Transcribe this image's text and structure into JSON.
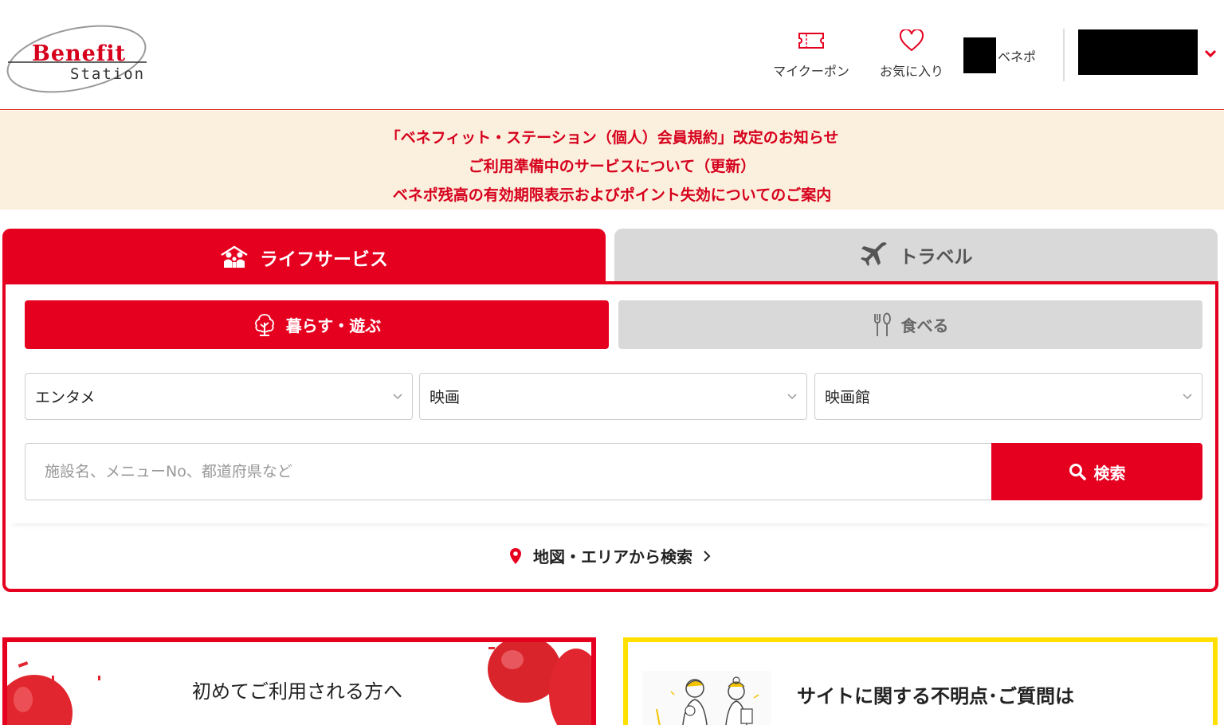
{
  "header": {
    "logo": {
      "line1": "Benefit",
      "line2": "Station"
    },
    "nav": {
      "coupon_label": "マイクーポン",
      "favorites_label": "お気に入り",
      "benepo_label": "ベネポ"
    },
    "icons": {
      "coupon": "ticket-icon",
      "favorites": "heart-icon",
      "user_menu": "chevron-down-icon"
    }
  },
  "notices": [
    "「ベネフィット・ステーション（個人）会員規約」改定のお知らせ",
    "ご利用準備中のサービスについて（更新）",
    "ベネポ残高の有効期限表示およびポイント失効についてのご案内"
  ],
  "main_tabs": [
    {
      "label": "ライフサービス",
      "icon": "family-icon",
      "active": true
    },
    {
      "label": "トラベル",
      "icon": "airplane-icon",
      "active": false
    }
  ],
  "sub_tabs": [
    {
      "label": "暮らす・遊ぶ",
      "icon": "tree-icon",
      "active": true
    },
    {
      "label": "食べる",
      "icon": "cutlery-icon",
      "active": false
    }
  ],
  "filters": {
    "category": "エンタメ",
    "subcategory": "映画",
    "type": "映画館"
  },
  "search": {
    "placeholder": "施設名、メニューNo、都道府県など",
    "button_label": "検索"
  },
  "map_search_label": "地図・エリアから検索",
  "banners": {
    "first_time_title": "初めてご利用される方へ",
    "faq_title": "サイトに関する不明点･ご質問は"
  },
  "colors": {
    "brand_red": "#e60020",
    "notice_bg": "#fbefdd",
    "inactive_tab": "#d9d9d9",
    "faq_border": "#ffe000"
  }
}
